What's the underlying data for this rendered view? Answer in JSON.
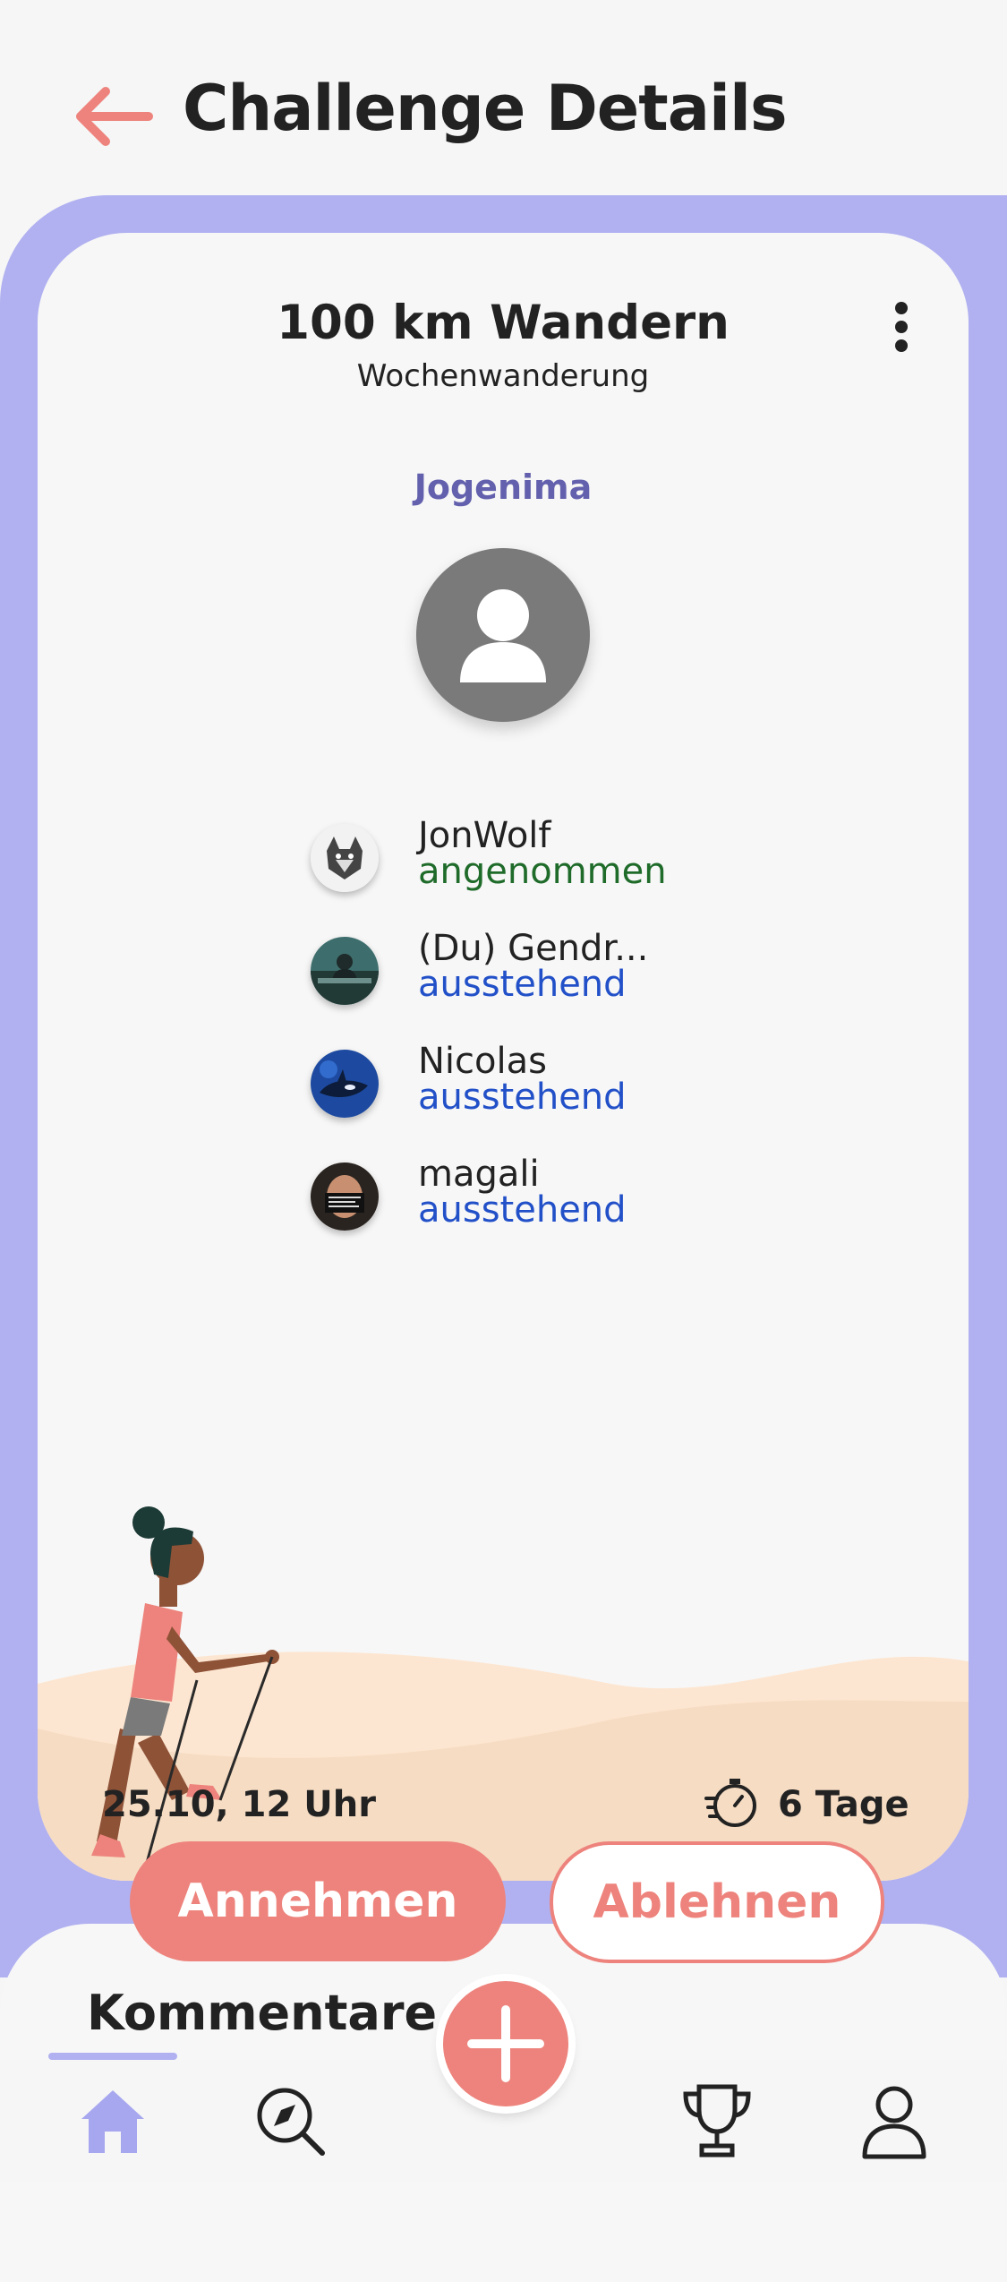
{
  "header": {
    "title": "Challenge Details"
  },
  "challenge": {
    "title": "100 km Wandern",
    "subtitle": "Wochenwanderung",
    "creator": "Jogenima",
    "date": "25.10, 12 Uhr",
    "duration": "6 Tage"
  },
  "participants": [
    {
      "name": "JonWolf",
      "status": "angenommen",
      "status_color": "#1f6b2a"
    },
    {
      "name": "(Du) Gendr...",
      "status": "ausstehend",
      "status_color": "#2250c8"
    },
    {
      "name": "Nicolas",
      "status": "ausstehend",
      "status_color": "#2250c8"
    },
    {
      "name": "magali",
      "status": "ausstehend",
      "status_color": "#2250c8"
    }
  ],
  "actions": {
    "accept_label": "Annehmen",
    "decline_label": "Ablehnen"
  },
  "comments": {
    "heading": "Kommentare"
  },
  "nav": {
    "items": [
      {
        "icon": "home-icon",
        "active": true
      },
      {
        "icon": "compass-search-icon",
        "active": false
      },
      {
        "icon": "add-icon",
        "active": false
      },
      {
        "icon": "trophy-icon",
        "active": false
      },
      {
        "icon": "profile-icon",
        "active": false
      }
    ]
  },
  "colors": {
    "accent_coral": "#ed837c",
    "accent_purple": "#b1b1f1",
    "creator_text": "#6361ad",
    "accepted_green": "#1f6b2a",
    "pending_blue": "#2250c8"
  }
}
